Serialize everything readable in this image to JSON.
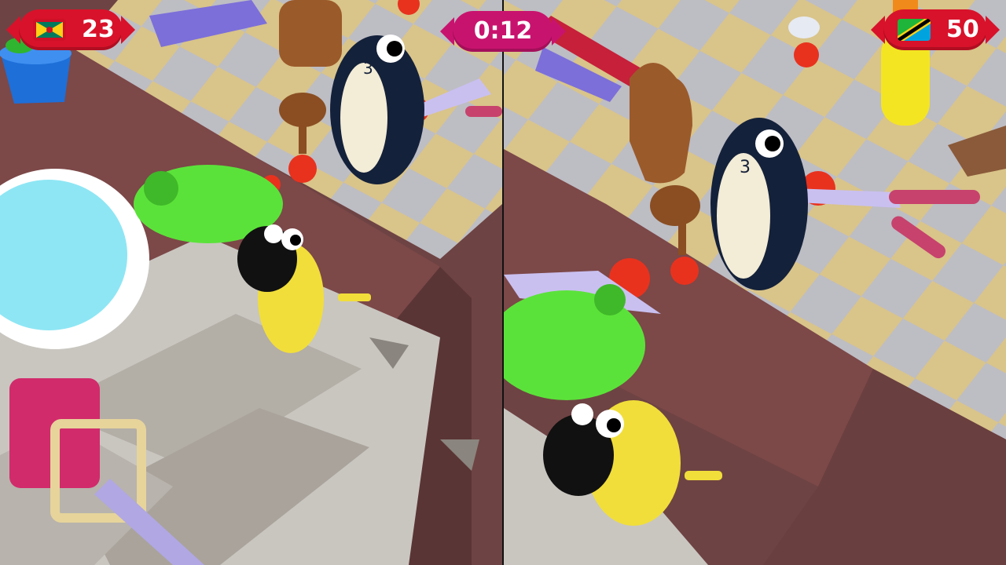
{
  "hud": {
    "left_score": "23",
    "timer": "0:12",
    "right_score": "50"
  },
  "players": {
    "left": {
      "flag_icon": "grenada-flag-icon",
      "jersey_number": "3"
    },
    "right": {
      "flag_icon": "tanzania-flag-icon",
      "jersey_number": "3"
    }
  },
  "colors": {
    "score_badge": "#d8122a",
    "timer_badge": "#c8136e",
    "floor_light": "#d9c48a",
    "floor_grey": "#bcbcc2",
    "counter": "#7c4848"
  }
}
